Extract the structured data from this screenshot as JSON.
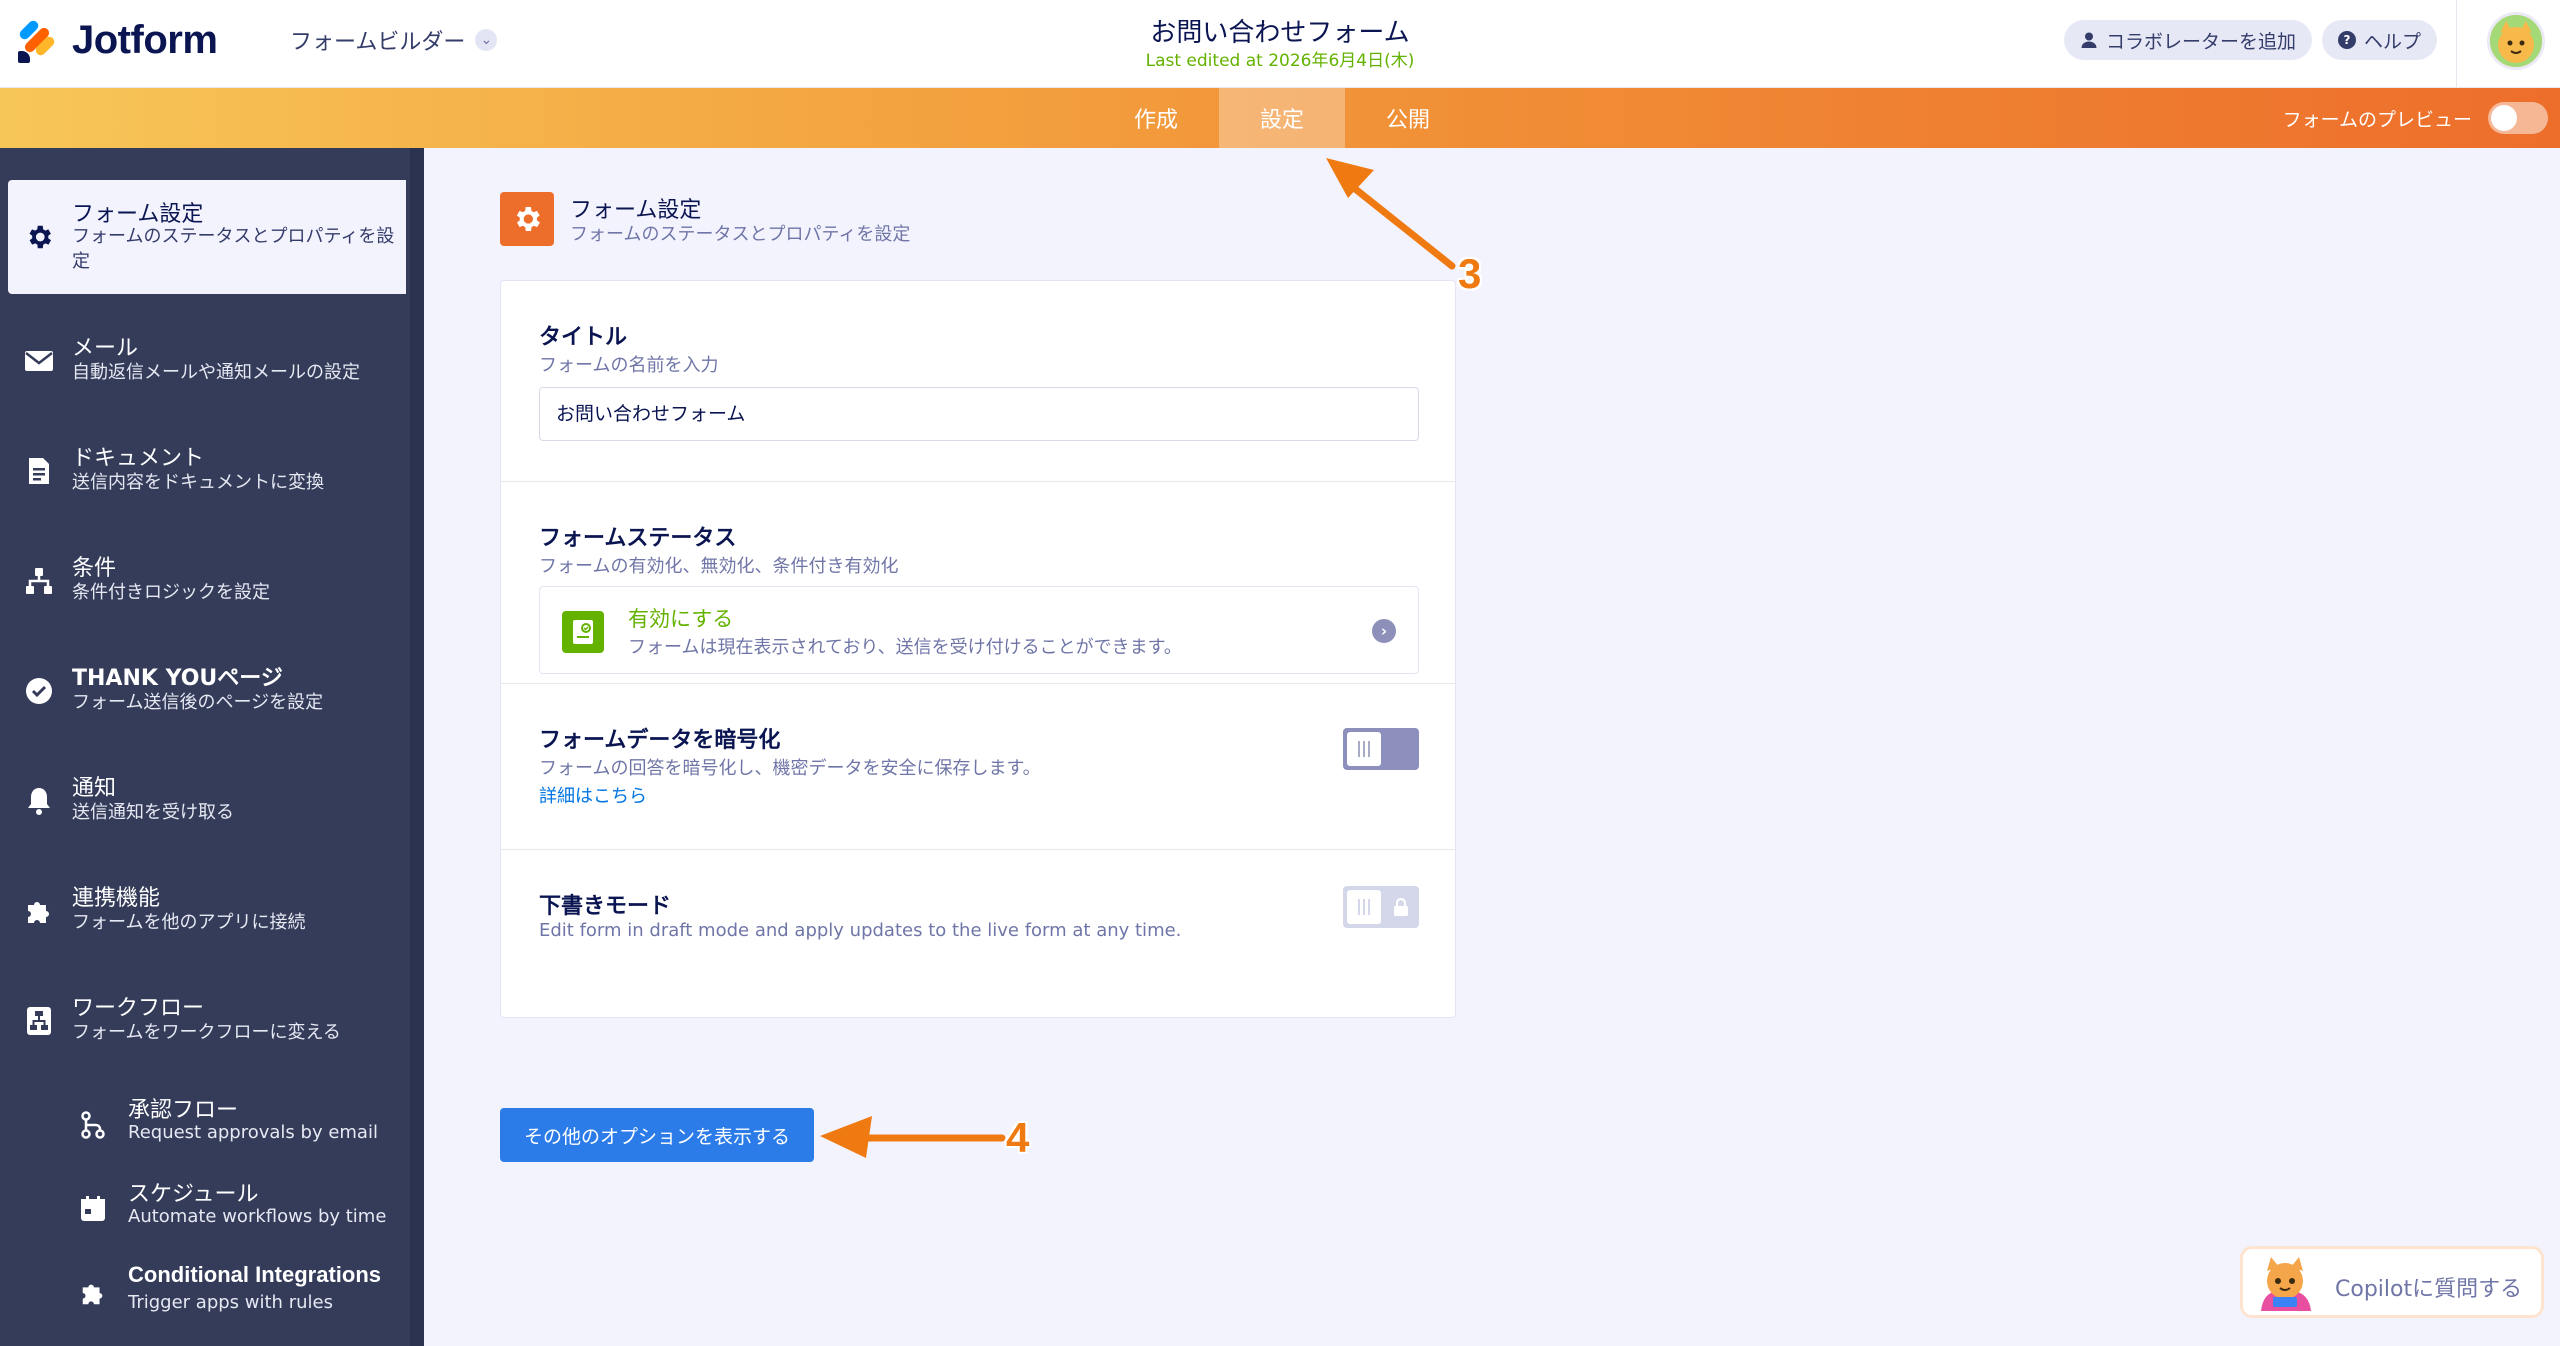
{
  "header": {
    "brand": "Jotform",
    "builder_label": "フォームビルダー",
    "form_title": "お問い合わせフォーム",
    "last_edited": "Last edited at 2026年6月4日(木)",
    "add_collaborator": "コラボレーターを追加",
    "help": "ヘルプ"
  },
  "nav": {
    "tabs": [
      {
        "label": "作成"
      },
      {
        "label": "設定",
        "active": true
      },
      {
        "label": "公開"
      }
    ],
    "preview_label": "フォームのプレビュー"
  },
  "sidebar": {
    "items": [
      {
        "icon": "gear-icon",
        "title": "フォーム設定",
        "subtitle": "フォームのステータスとプロパティを設定",
        "active": true
      },
      {
        "icon": "mail-icon",
        "title": "メール",
        "subtitle": "自動返信メールや通知メールの設定"
      },
      {
        "icon": "document-icon",
        "title": "ドキュメント",
        "subtitle": "送信内容をドキュメントに変換"
      },
      {
        "icon": "conditions-icon",
        "title": "条件",
        "subtitle": "条件付きロジックを設定"
      },
      {
        "icon": "check-circle-icon",
        "title": "THANK YOUページ",
        "subtitle": "フォーム送信後のページを設定"
      },
      {
        "icon": "bell-icon",
        "title": "通知",
        "subtitle": "送信通知を受け取る"
      },
      {
        "icon": "puzzle-icon",
        "title": "連携機能",
        "subtitle": "フォームを他のアプリに接続"
      },
      {
        "icon": "workflow-icon",
        "title": "ワークフロー",
        "subtitle": "フォームをワークフローに変える"
      }
    ],
    "subitems": [
      {
        "icon": "approval-flow-icon",
        "title": "承認フロー",
        "subtitle": "Request approvals by email"
      },
      {
        "icon": "calendar-icon",
        "title": "スケジュール",
        "subtitle": "Automate workflows by time"
      },
      {
        "icon": "puzzle-icon",
        "title": "Conditional Integrations",
        "subtitle": "Trigger apps with rules"
      }
    ]
  },
  "main": {
    "section_title": "フォーム設定",
    "section_subtitle": "フォームのステータスとプロパティを設定",
    "title_field": {
      "label": "タイトル",
      "description": "フォームの名前を入力",
      "value": "お問い合わせフォーム"
    },
    "status": {
      "label": "フォームステータス",
      "description": "フォームの有効化、無効化、条件付き有効化",
      "option_title": "有効にする",
      "option_desc": "フォームは現在表示されており、送信を受け付けることができます。"
    },
    "encryption": {
      "label": "フォームデータを暗号化",
      "description": "フォームの回答を暗号化し、機密データを安全に保存します。",
      "link": "詳細はこちら"
    },
    "draft": {
      "label": "下書きモード",
      "description": "Edit form in draft mode and apply updates to the live form at any time."
    },
    "more_options": "その他のオプションを表示する"
  },
  "copilot": {
    "label": "Copilotに質問する"
  },
  "annotations": {
    "step3": "3",
    "step4": "4",
    "color": "#f07a12"
  },
  "colors": {
    "accent_orange": "#ed6e2b",
    "sidebar_bg": "#343c5a",
    "active_green": "#64b200",
    "button_blue": "#2b7be8"
  }
}
